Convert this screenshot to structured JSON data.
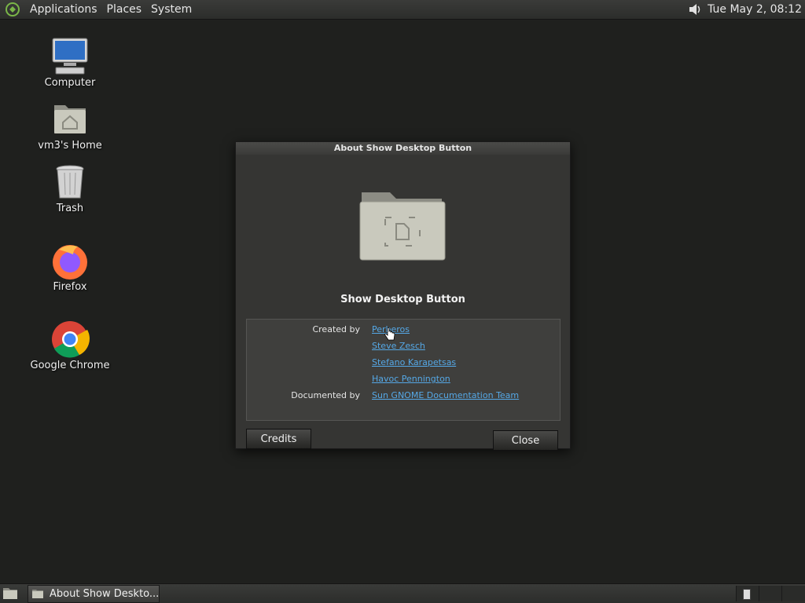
{
  "top_panel": {
    "menus": [
      "Applications",
      "Places",
      "System"
    ],
    "clock": "Tue May  2, 08:12"
  },
  "desktop": {
    "icons": [
      {
        "label": "Computer",
        "icon": "computer-icon"
      },
      {
        "label": "vm3's Home",
        "icon": "home-folder-icon"
      },
      {
        "label": "Trash",
        "icon": "trash-icon"
      },
      {
        "label": "Firefox",
        "icon": "firefox-icon"
      },
      {
        "label": "Google Chrome",
        "icon": "chrome-icon"
      }
    ]
  },
  "dialog": {
    "title": "About Show Desktop Button",
    "app_name": "Show Desktop Button",
    "created_by_label": "Created by",
    "authors": [
      "Perberos",
      "Steve Zesch",
      "Stefano Karapetsas",
      "Havoc Pennington"
    ],
    "documented_by_label": "Documented by",
    "documenters": [
      "Sun GNOME Documentation Team"
    ],
    "credits_button": "Credits",
    "close_button": "Close"
  },
  "taskbar": {
    "task_label": "About Show Deskto..."
  },
  "colors": {
    "link": "#55a8e6",
    "desktop_bg": "#1f201e",
    "dialog_bg": "#353533"
  }
}
